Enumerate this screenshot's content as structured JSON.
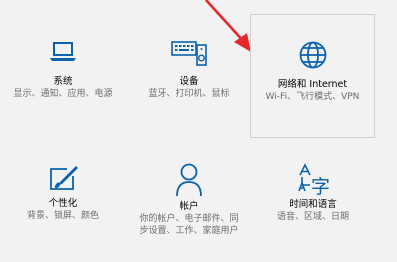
{
  "colors": {
    "accent": "#0a63b0",
    "arrow": "#e5282b"
  },
  "tiles": [
    {
      "title": "系统",
      "desc": "显示、通知、应用、电源",
      "icon": "laptop-icon"
    },
    {
      "title": "设备",
      "desc": "蓝牙、打印机、鼠标",
      "icon": "keyboard-speaker-icon"
    },
    {
      "title": "网络和 Internet",
      "desc": "Wi-Fi、飞行模式、VPN",
      "icon": "globe-icon"
    },
    {
      "title": "个性化",
      "desc": "背景、锁屏、颜色",
      "icon": "paint-icon"
    },
    {
      "title": "帐户",
      "desc": "你的帐户、电子邮件、同步设置、工作、家庭用户",
      "icon": "person-icon"
    },
    {
      "title": "时间和语言",
      "desc": "语音、区域、日期",
      "icon": "time-language-icon"
    }
  ]
}
